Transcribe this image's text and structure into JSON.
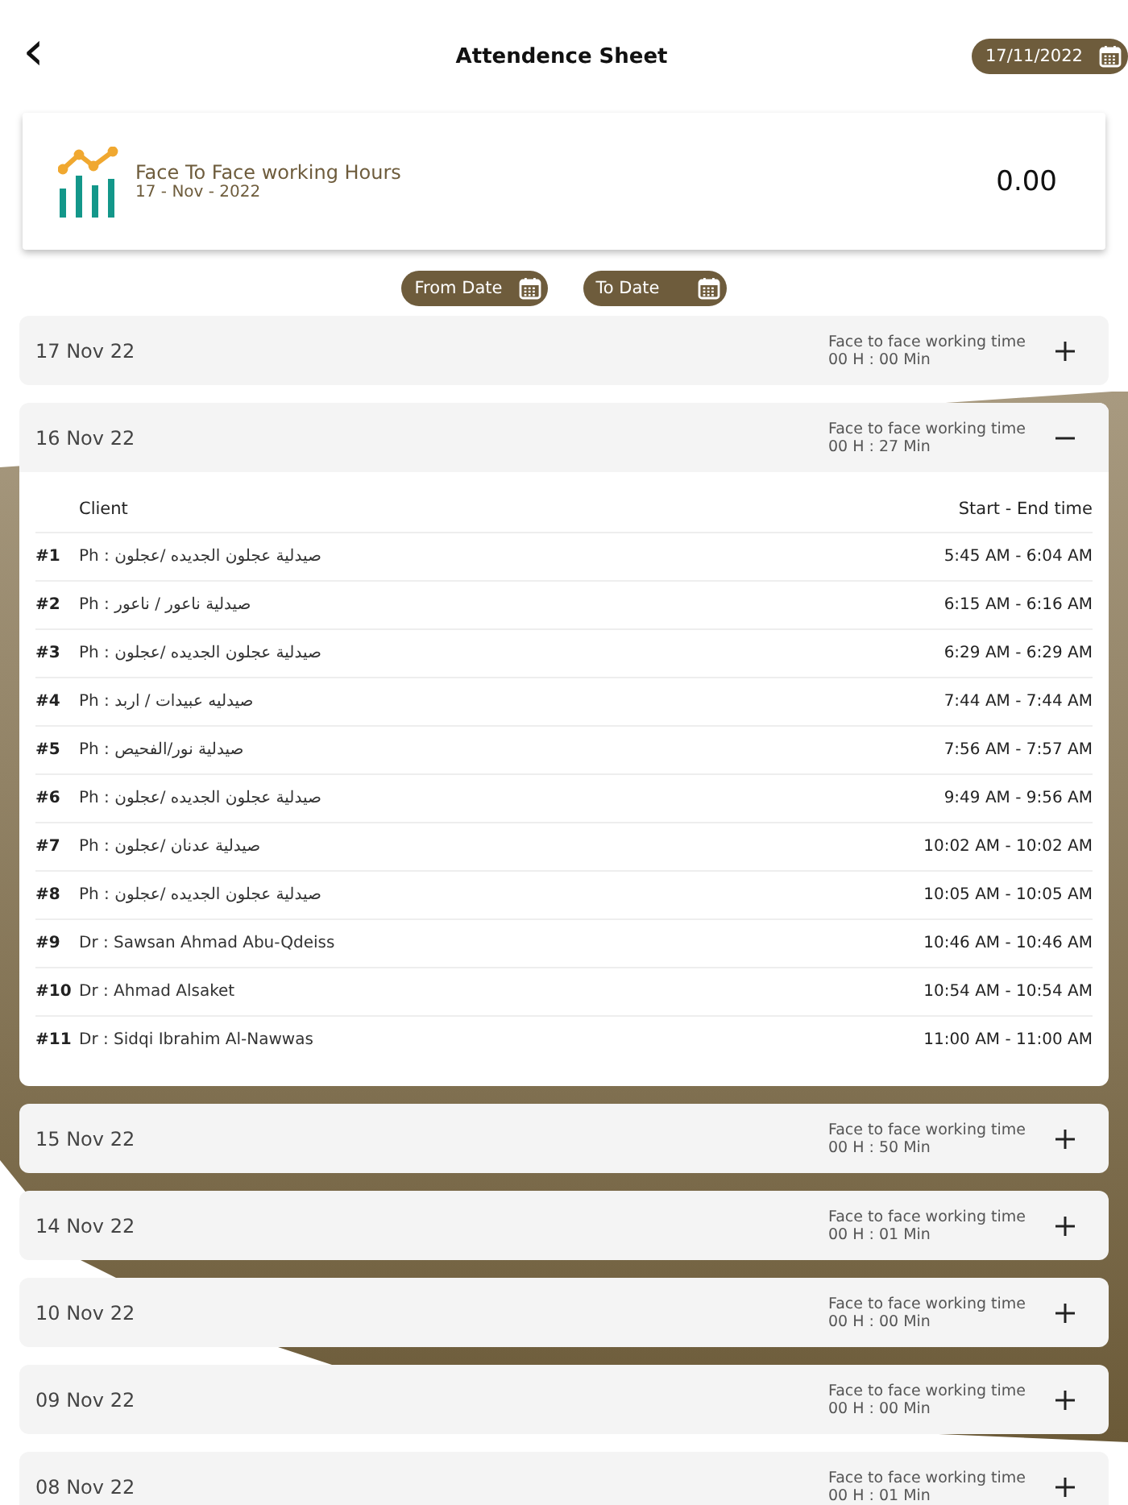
{
  "header": {
    "back": "‹",
    "title": "Attendence Sheet",
    "date": "17/11/2022"
  },
  "summary": {
    "title": "Face To Face working Hours",
    "date": "17 - Nov - 2022",
    "value": "0.00"
  },
  "filters": [
    {
      "label": "From Date"
    },
    {
      "label": "To Date"
    }
  ],
  "columns": [
    "Client",
    "Start - End time"
  ],
  "days": [
    {
      "date": "17 Nov 22",
      "label": "Face to face working time",
      "duration": "00 H : 00 Min",
      "expanded": false
    },
    {
      "date": "16 Nov 22",
      "label": "Face to face working time",
      "duration": "00 H : 27 Min",
      "expanded": true,
      "entries": [
        {
          "index": "#1",
          "client": "Ph : صيدلية عجلون الجديده /عجلون",
          "time": "5:45 AM - 6:04 AM"
        },
        {
          "index": "#2",
          "client": "Ph : صيدلية ناعور / ناعور",
          "time": "6:15 AM - 6:16 AM"
        },
        {
          "index": "#3",
          "client": "Ph : صيدلية عجلون الجديده /عجلون",
          "time": "6:29 AM - 6:29 AM"
        },
        {
          "index": "#4",
          "client": "Ph : صيدليه عبيدات / اربد",
          "time": "7:44 AM - 7:44 AM"
        },
        {
          "index": "#5",
          "client": "Ph : صيدلية نور/الفحيص",
          "time": "7:56 AM - 7:57 AM"
        },
        {
          "index": "#6",
          "client": "Ph : صيدلية عجلون الجديده /عجلون",
          "time": "9:49 AM - 9:56 AM"
        },
        {
          "index": "#7",
          "client": "Ph : صيدلية عدنان /عجلون",
          "time": "10:02 AM - 10:02 AM"
        },
        {
          "index": "#8",
          "client": "Ph : صيدلية عجلون الجديده /عجلون",
          "time": "10:05 AM - 10:05 AM"
        },
        {
          "index": "#9",
          "client": "Dr : Sawsan Ahmad Abu-Qdeiss",
          "time": "10:46 AM - 10:46 AM"
        },
        {
          "index": "#10",
          "client": "Dr : Ahmad Alsaket",
          "time": "10:54 AM - 10:54 AM"
        },
        {
          "index": "#11",
          "client": "Dr : Sidqi Ibrahim Al-Nawwas",
          "time": "11:00 AM - 11:00 AM"
        }
      ]
    },
    {
      "date": "15 Nov 22",
      "label": "Face to face working time",
      "duration": "00 H : 50 Min",
      "expanded": false
    },
    {
      "date": "14 Nov 22",
      "label": "Face to face working time",
      "duration": "00 H : 01 Min",
      "expanded": false
    },
    {
      "date": "10 Nov 22",
      "label": "Face to face working time",
      "duration": "00 H : 00 Min",
      "expanded": false
    },
    {
      "date": "09 Nov 22",
      "label": "Face to face working time",
      "duration": "00 H : 00 Min",
      "expanded": false
    },
    {
      "date": "08 Nov 22",
      "label": "Face to face working time",
      "duration": "00 H : 01 Min",
      "expanded": false
    }
  ]
}
